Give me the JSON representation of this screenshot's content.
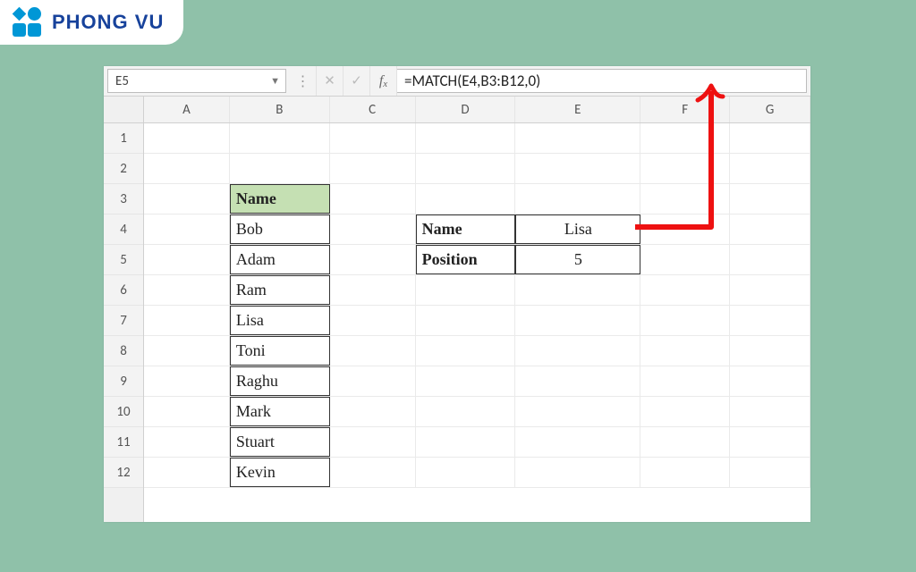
{
  "brand": {
    "name": "PHONG VU"
  },
  "formula_bar": {
    "cell_ref": "E5",
    "formula": "=MATCH(E4,B3:B12,0)"
  },
  "columns": [
    "A",
    "B",
    "C",
    "D",
    "E",
    "F",
    "G"
  ],
  "rows": [
    "1",
    "2",
    "3",
    "4",
    "5",
    "6",
    "7",
    "8",
    "9",
    "10",
    "11",
    "12"
  ],
  "list": {
    "header": "Name",
    "items": [
      "Bob",
      "Adam",
      "Ram",
      "Lisa",
      "Toni",
      "Raghu",
      "Mark",
      "Stuart",
      "Kevin"
    ]
  },
  "lookup": {
    "name_label": "Name",
    "name_value": "Lisa",
    "position_label": "Position",
    "position_value": "5"
  }
}
